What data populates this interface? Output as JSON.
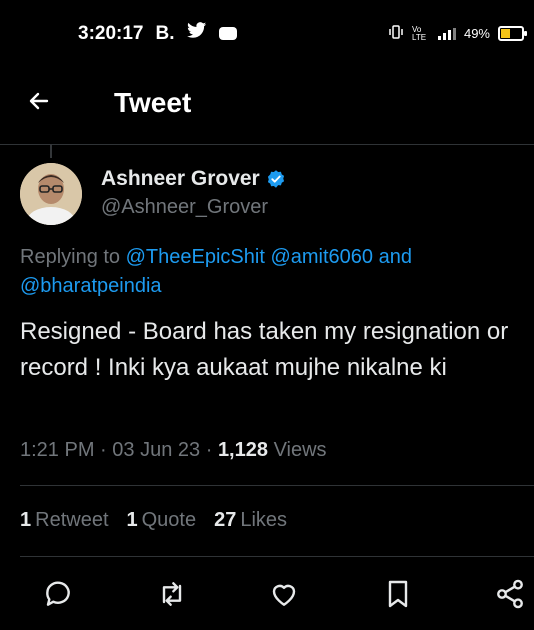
{
  "status_bar": {
    "time": "3:20:17",
    "carrier_label": "B.",
    "battery_percent": "49%",
    "network_label": "Vo LTE"
  },
  "header": {
    "back_icon": "arrow-left-icon",
    "title": "Tweet"
  },
  "tweet": {
    "author_name": "Ashneer Grover",
    "verified": true,
    "handle": "@Ashneer_Grover",
    "replying_prefix": "Replying to",
    "mention_1": "@TheeEpicShit",
    "mention_2": "@amit6060",
    "and_word": "and",
    "mention_3": "@bharatpeindia",
    "text": "Resigned - Board has taken my resignation or record ! Inki kya aukaat mujhe nikalne ki",
    "time": "1:21 PM",
    "date": "03 Jun 23",
    "views_count": "1,128",
    "views_label": "Views"
  },
  "stats": {
    "retweets_count": "1",
    "retweets_label": "Retweet",
    "quotes_count": "1",
    "quotes_label": "Quote",
    "likes_count": "27",
    "likes_label": "Likes"
  },
  "colors": {
    "background": "#000000",
    "text": "#e7e9ea",
    "muted": "#71767b",
    "link": "#1d9bf0",
    "divider": "#2f3336"
  }
}
